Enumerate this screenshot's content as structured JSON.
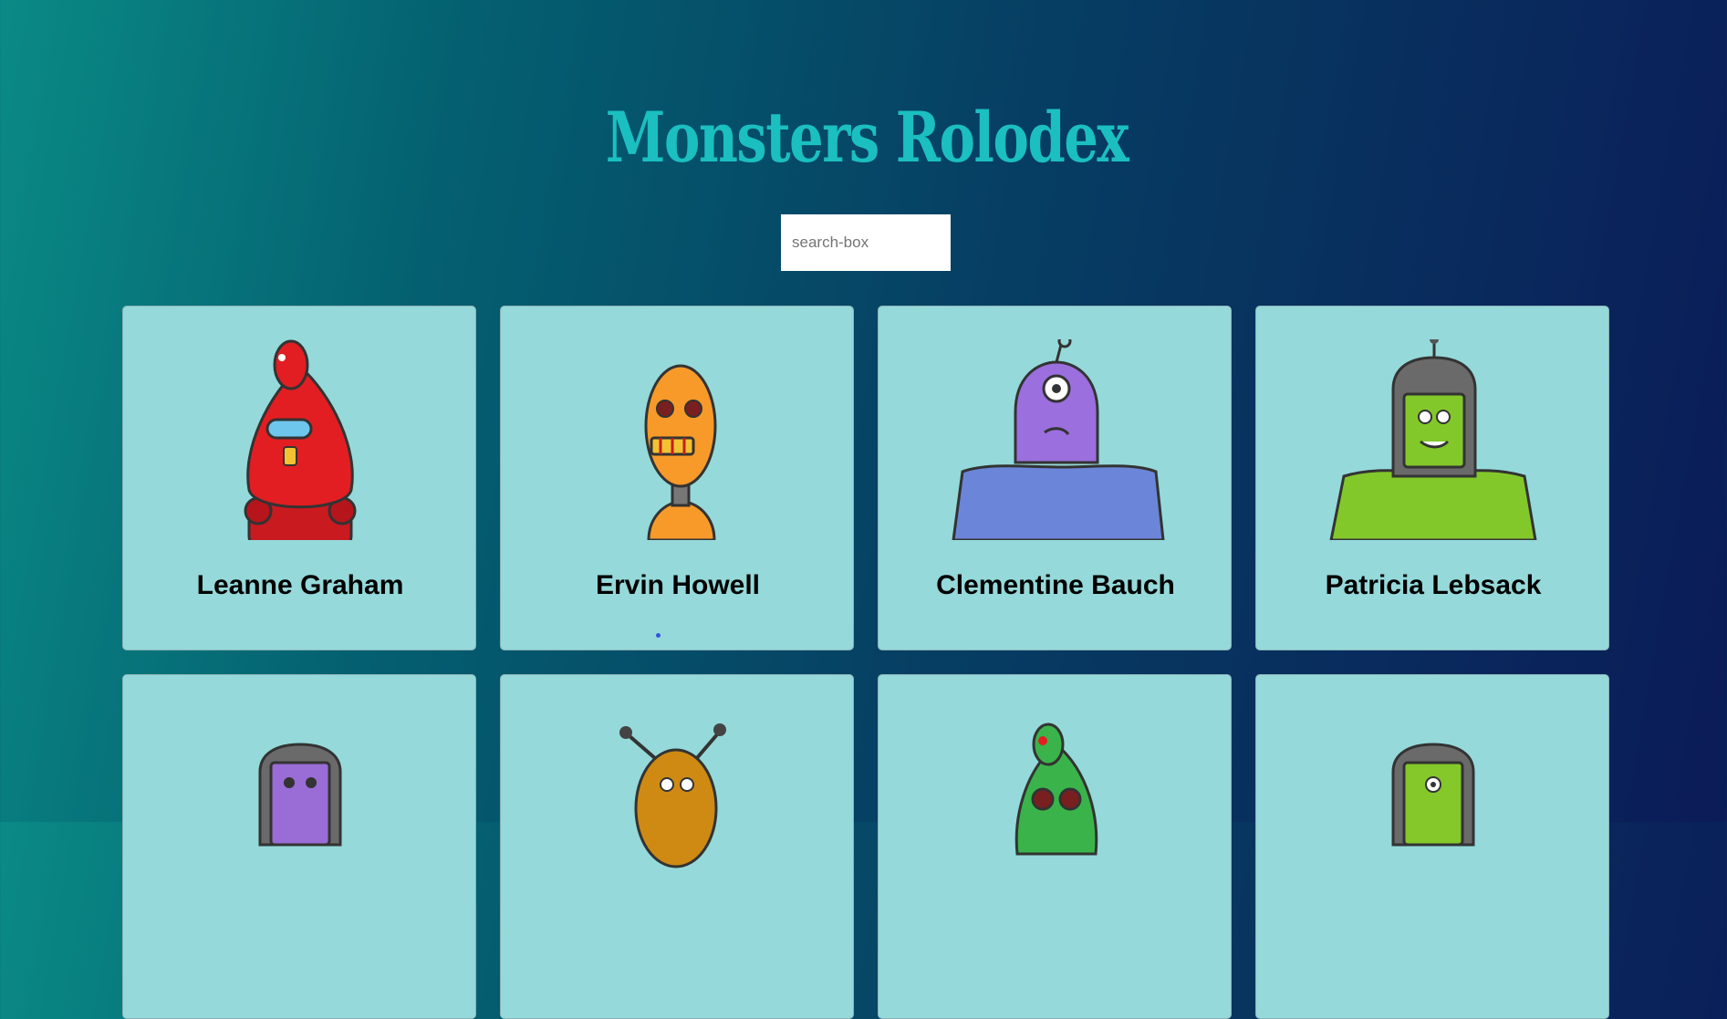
{
  "app": {
    "title": "Monsters Rolodex"
  },
  "search": {
    "placeholder": "search-box",
    "value": ""
  },
  "monsters": [
    {
      "name": "Leanne Graham",
      "color": "#e21e22",
      "icon": "red-robot-monster-avatar"
    },
    {
      "name": "Ervin Howell",
      "color": "#f79a2a",
      "icon": "orange-robot-monster-avatar"
    },
    {
      "name": "Clementine Bauch",
      "color": "#9b6fdd",
      "icon": "purple-cyclops-monster-avatar"
    },
    {
      "name": "Patricia Lebsack",
      "color": "#83c82a",
      "icon": "green-helmet-monster-avatar"
    },
    {
      "name": "",
      "color": "#9a6cd6",
      "icon": "purple-robot-monster-avatar"
    },
    {
      "name": "",
      "color": "#cf8a14",
      "icon": "gold-antenna-monster-avatar"
    },
    {
      "name": "",
      "color": "#3ab44a",
      "icon": "green-robot-monster-avatar"
    },
    {
      "name": "",
      "color": "#84c82a",
      "icon": "green-helmet-monster-avatar-2"
    }
  ]
}
